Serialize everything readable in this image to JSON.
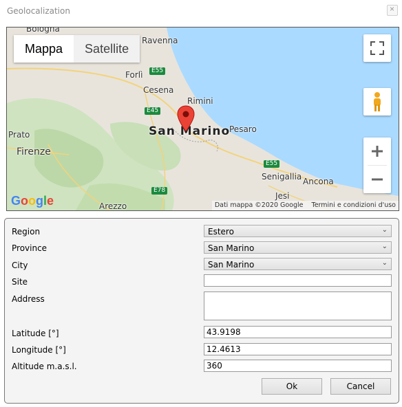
{
  "window": {
    "title": "Geolocalization"
  },
  "map": {
    "type_buttons": {
      "map": "Mappa",
      "satellite": "Satellite"
    },
    "places": {
      "bologna": "Bologna",
      "ravenna": "Ravenna",
      "forli": "Forlì",
      "cesena": "Cesena",
      "rimini": "Rimini",
      "san_marino": "San Marino",
      "pesaro": "Pesaro",
      "prato": "Prato",
      "firenze": "Firenze",
      "senigallia": "Senigallia",
      "ancona": "Ancona",
      "jesi": "Jesi",
      "arezzo": "Arezzo"
    },
    "roads": {
      "e55_top": "E55",
      "e45": "E45",
      "e55_bottom": "E55",
      "e78": "E78"
    },
    "logo": "Google",
    "attribution": {
      "data": "Dati mappa ©2020 Google",
      "terms": "Termini e condizioni d'uso"
    },
    "colors": {
      "sea": "#aadaff",
      "land": "#e8e4dc",
      "green": "#c8dfb8",
      "marker": "#ea4335"
    }
  },
  "form": {
    "region": {
      "label": "Region",
      "value": "Estero"
    },
    "province": {
      "label": "Province",
      "value": "San Marino"
    },
    "city": {
      "label": "City",
      "value": "San Marino"
    },
    "site": {
      "label": "Site",
      "value": ""
    },
    "address": {
      "label": "Address",
      "value": ""
    },
    "latitude": {
      "label": "Latitude [°]",
      "value": "43.9198"
    },
    "longitude": {
      "label": "Longitude [°]",
      "value": "12.4613"
    },
    "altitude": {
      "label": "Altitude m.a.s.l.",
      "value": "360"
    },
    "ok_label": "Ok",
    "cancel_label": "Cancel"
  }
}
